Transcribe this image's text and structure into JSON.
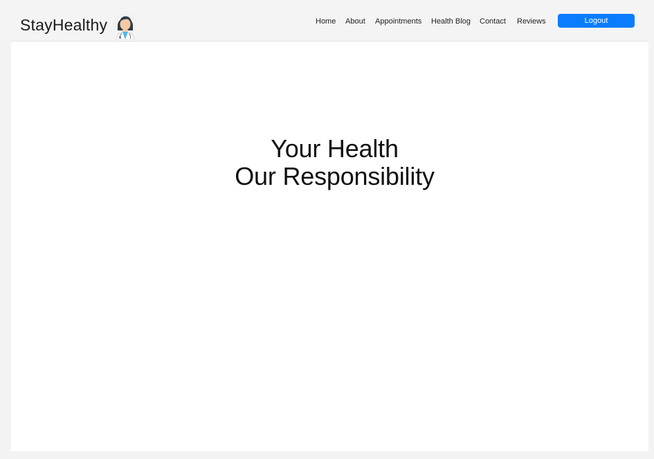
{
  "brand": {
    "name": "StayHealthy",
    "icon": "doctor-icon"
  },
  "nav": {
    "items": [
      "Home",
      "About",
      "Appointments",
      "Health Blog",
      "Contact",
      "Reviews"
    ],
    "logout_label": "Logout"
  },
  "hero": {
    "line1": "Your Health",
    "line2": "Our Responsibility"
  },
  "colors": {
    "accent": "#0a7cff",
    "header_bg": "#f4f4f4",
    "content_bg": "#ffffff"
  }
}
